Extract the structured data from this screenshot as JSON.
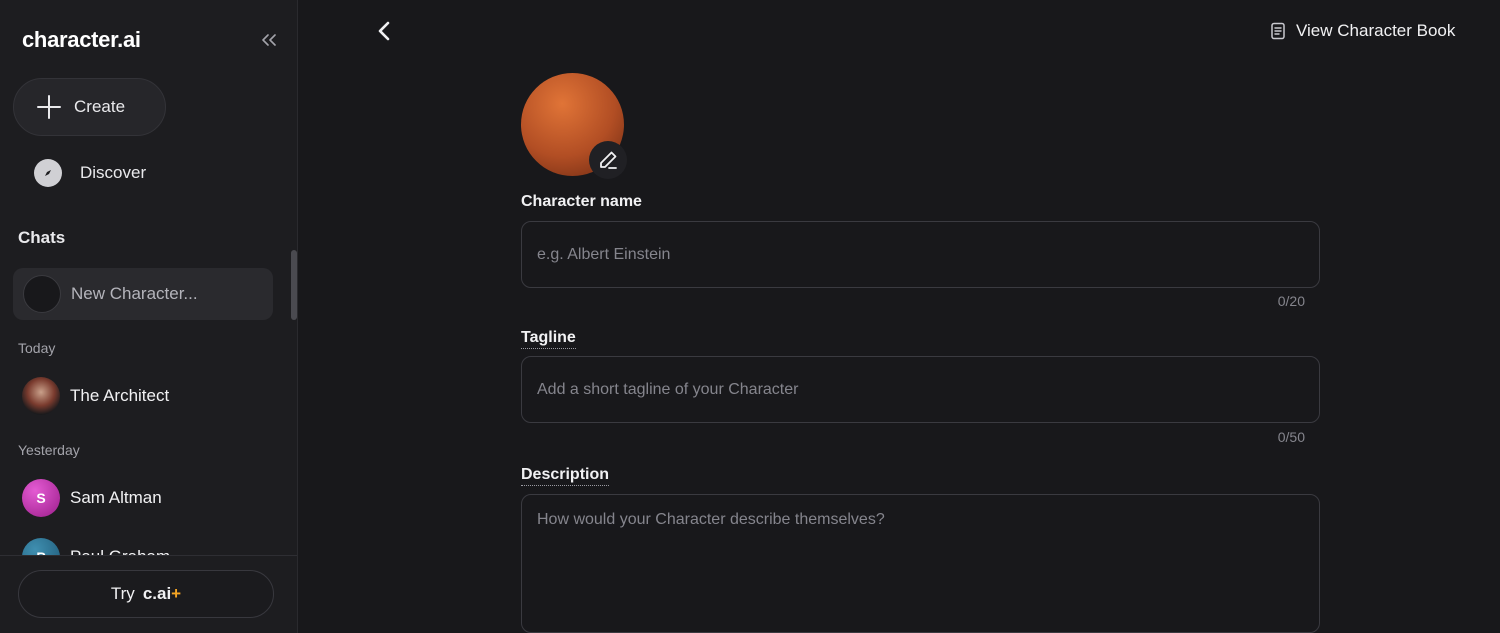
{
  "sidebar": {
    "logo": "character.ai",
    "create_label": "Create",
    "discover_label": "Discover",
    "chats_title": "Chats",
    "active_chat": "New Character...",
    "sections": [
      {
        "label": "Today",
        "items": [
          {
            "name": "The Architect"
          }
        ]
      },
      {
        "label": "Yesterday",
        "items": [
          {
            "name": "Sam Altman",
            "initial": "S"
          },
          {
            "name": "Paul Graham",
            "initial": "P"
          }
        ]
      }
    ],
    "try_label": "Try",
    "try_brand": "c.ai",
    "try_plus": "+"
  },
  "header": {
    "book_label": "View Character Book"
  },
  "form": {
    "name": {
      "label": "Character name",
      "placeholder": "e.g. Albert Einstein",
      "counter": "0/20"
    },
    "tagline": {
      "label": "Tagline",
      "placeholder": "Add a short tagline of your Character",
      "counter": "0/50"
    },
    "description": {
      "label": "Description",
      "placeholder": "How would your Character describe themselves?"
    }
  },
  "colors": {
    "background": "#18181b",
    "sidebar": "#1d1d20",
    "accent_plus": "#f5a524",
    "avatar_orange": "#e07437"
  }
}
